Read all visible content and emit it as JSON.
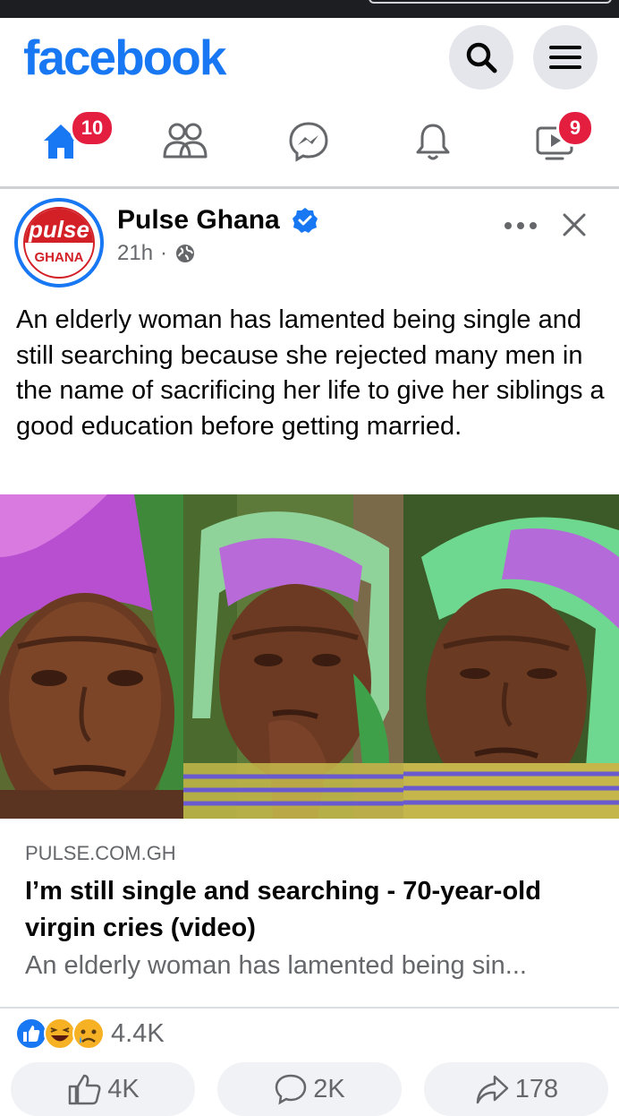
{
  "app": {
    "logo": "facebook",
    "brand_color": "#1877f2",
    "badge_color": "#e41e3f"
  },
  "nav": {
    "home_badge": "10",
    "watch_badge": "9",
    "items": [
      "home-icon",
      "friends-icon",
      "messenger-icon",
      "bell-icon",
      "watch-icon"
    ]
  },
  "post": {
    "page_name": "Pulse Ghana",
    "avatar_top": "pulse",
    "avatar_bottom": "GHANA",
    "time": "21h",
    "separator": "·",
    "text": "An elderly woman has lamented being single and still searching because she rejected many men in the name of sacrificing her life to give her siblings a good education before getting married."
  },
  "link": {
    "domain": "PULSE.COM.GH",
    "title": "I’m still single and searching - 70-year-old virgin cries (video)",
    "description": "An elderly woman has lamented being sin..."
  },
  "reactions": {
    "count": "4.4K",
    "icons": [
      "like-icon",
      "haha-icon",
      "sad-icon"
    ]
  },
  "actions": {
    "like_count": "4K",
    "comment_count": "2K",
    "share_count": "178"
  }
}
